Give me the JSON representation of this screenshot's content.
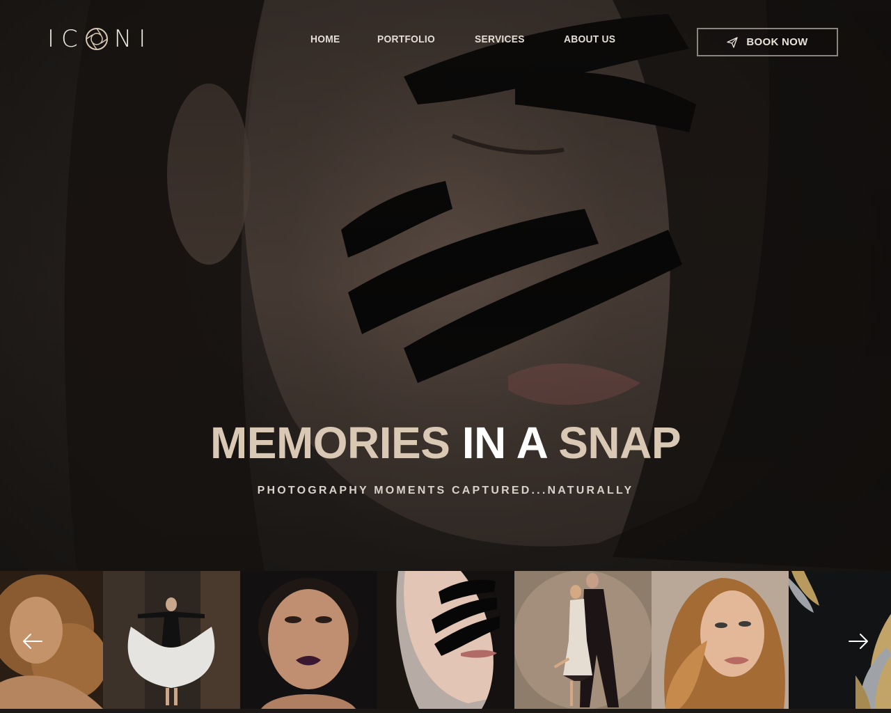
{
  "brand": {
    "logo_left": "IC",
    "logo_right": "NI"
  },
  "nav": {
    "items": [
      {
        "label": "HOME"
      },
      {
        "label": "PORTFOLIO"
      },
      {
        "label": "SERVICES"
      },
      {
        "label": "ABOUT US"
      }
    ]
  },
  "cta": {
    "label": "BOOK NOW",
    "icon": "paper-plane-icon"
  },
  "hero": {
    "headline_part1": "MEMORIES",
    "headline_part2": " IN A ",
    "headline_part3": "SNAP",
    "subheadline": "PHOTOGRAPHY MOMENTS CAPTURED...NATURALLY"
  },
  "gallery": {
    "prev_icon": "arrow-left-icon",
    "next_icon": "arrow-right-icon",
    "items": [
      {
        "subject": "curly-hair-portrait"
      },
      {
        "subject": "ballet-dancer"
      },
      {
        "subject": "wet-hair-beauty-portrait"
      },
      {
        "subject": "face-paint-portrait"
      },
      {
        "subject": "tango-dancers"
      },
      {
        "subject": "blonde-portrait"
      },
      {
        "subject": "gold-leaves-still-life"
      }
    ]
  },
  "colors": {
    "accent": "#d8c8b4",
    "background": "#1a1715",
    "text_light": "#ffffff",
    "button_border": "#8b8580"
  }
}
